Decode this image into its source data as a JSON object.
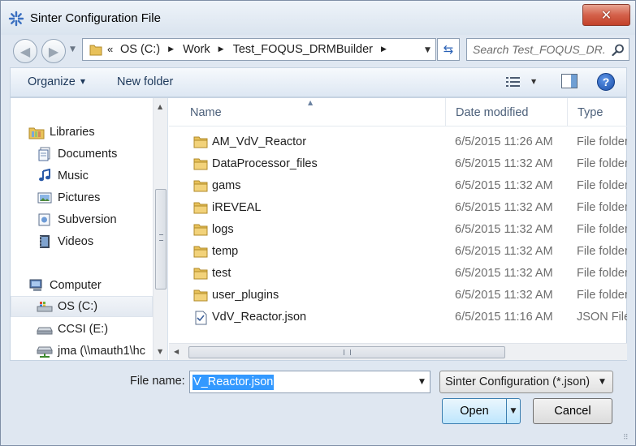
{
  "window": {
    "title": "Sinter Configuration File",
    "close_label": "✕"
  },
  "address": {
    "overflow": "«",
    "crumbs": [
      "OS (C:)",
      "Work",
      "Test_FOQUS_DRMBuilder"
    ],
    "separator": "▶"
  },
  "search": {
    "placeholder": "Search Test_FOQUS_DR..."
  },
  "toolbar": {
    "organize_label": "Organize",
    "new_folder_label": "New folder"
  },
  "nav": {
    "libraries": "Libraries",
    "items": [
      {
        "label": "Documents",
        "icon": "documents-icon"
      },
      {
        "label": "Music",
        "icon": "music-icon"
      },
      {
        "label": "Pictures",
        "icon": "pictures-icon"
      },
      {
        "label": "Subversion",
        "icon": "subversion-icon"
      },
      {
        "label": "Videos",
        "icon": "videos-icon"
      }
    ],
    "computer": "Computer",
    "drives": [
      {
        "label": "OS (C:)",
        "icon": "os-drive-icon",
        "selected": true
      },
      {
        "label": "CCSI (E:)",
        "icon": "drive-icon",
        "selected": false
      },
      {
        "label": "jma (\\\\mauth1\\hc",
        "icon": "network-drive-icon",
        "selected": false
      }
    ]
  },
  "columns": {
    "name": "Name",
    "date": "Date modified",
    "type": "Type"
  },
  "files": [
    {
      "name": "AM_VdV_Reactor",
      "date": "6/5/2015 11:26 AM",
      "type": "File folder",
      "kind": "folder"
    },
    {
      "name": "DataProcessor_files",
      "date": "6/5/2015 11:32 AM",
      "type": "File folder",
      "kind": "folder"
    },
    {
      "name": "gams",
      "date": "6/5/2015 11:32 AM",
      "type": "File folder",
      "kind": "folder"
    },
    {
      "name": "iREVEAL",
      "date": "6/5/2015 11:32 AM",
      "type": "File folder",
      "kind": "folder"
    },
    {
      "name": "logs",
      "date": "6/5/2015 11:32 AM",
      "type": "File folder",
      "kind": "folder"
    },
    {
      "name": "temp",
      "date": "6/5/2015 11:32 AM",
      "type": "File folder",
      "kind": "folder"
    },
    {
      "name": "test",
      "date": "6/5/2015 11:32 AM",
      "type": "File folder",
      "kind": "folder"
    },
    {
      "name": "user_plugins",
      "date": "6/5/2015 11:32 AM",
      "type": "File folder",
      "kind": "folder"
    },
    {
      "name": "VdV_Reactor.json",
      "date": "6/5/2015 11:16 AM",
      "type": "JSON File",
      "kind": "file"
    }
  ],
  "footer": {
    "filename_label": "File name:",
    "filename_value": "V_Reactor.json",
    "filetype_value": "Sinter Configuration (*.json)",
    "open_label": "Open",
    "cancel_label": "Cancel"
  },
  "colors": {
    "accent": "#3399ff",
    "folder": "#e8c15a",
    "toolbar_text": "#1e395b"
  }
}
